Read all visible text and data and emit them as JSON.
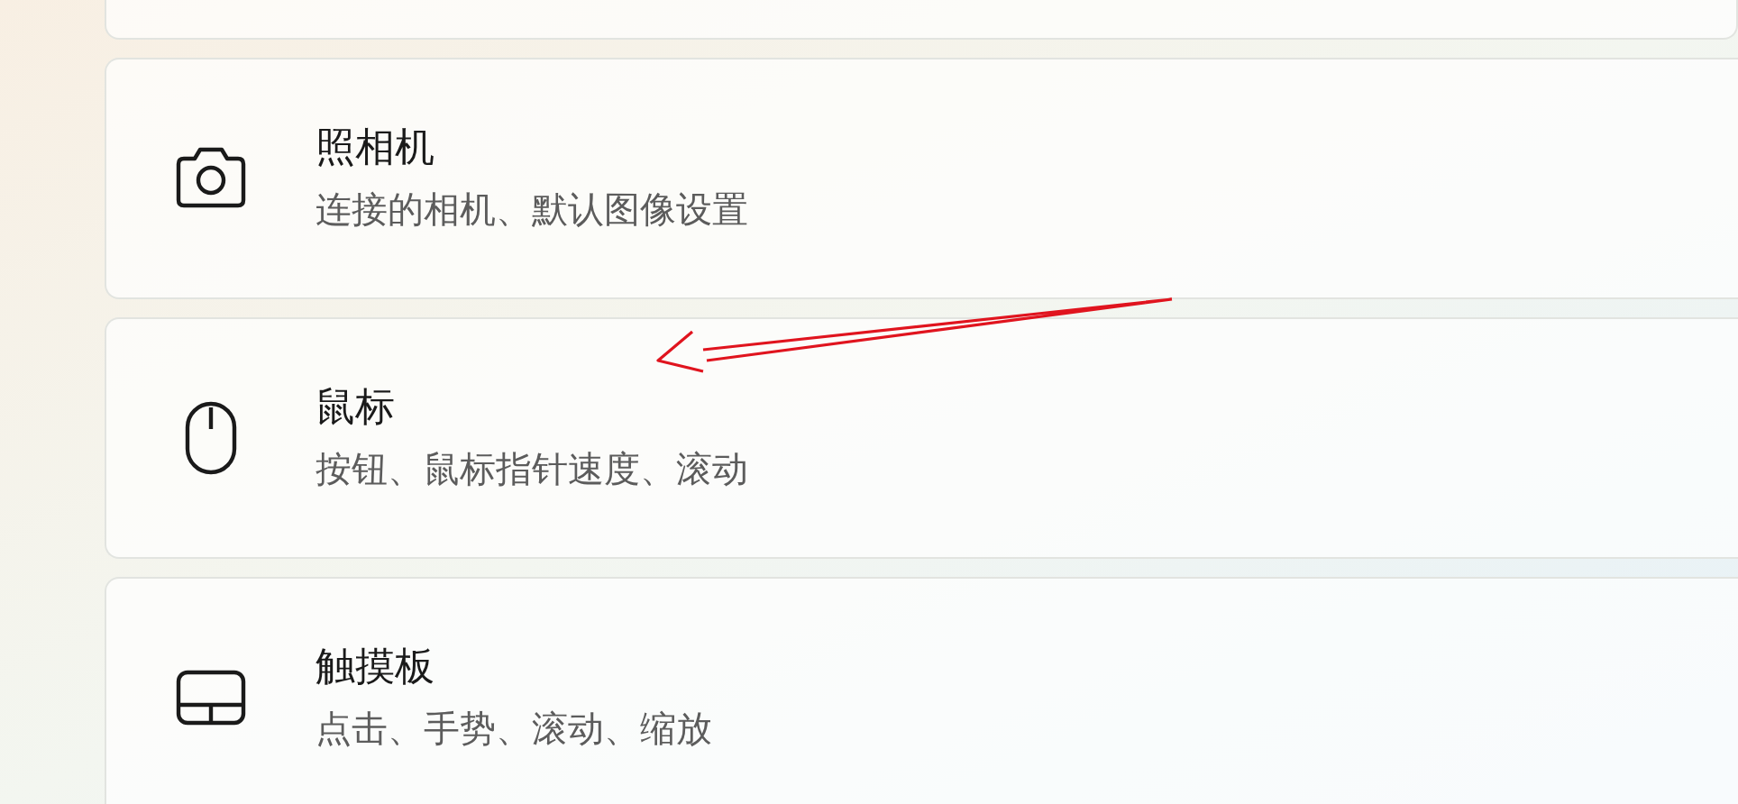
{
  "settings_items": [
    {
      "title": "照相机",
      "subtitle": "连接的相机、默认图像设置"
    },
    {
      "title": "鼠标",
      "subtitle": "按钮、鼠标指针速度、滚动"
    },
    {
      "title": "触摸板",
      "subtitle": "点击、手势、滚动、缩放"
    }
  ]
}
